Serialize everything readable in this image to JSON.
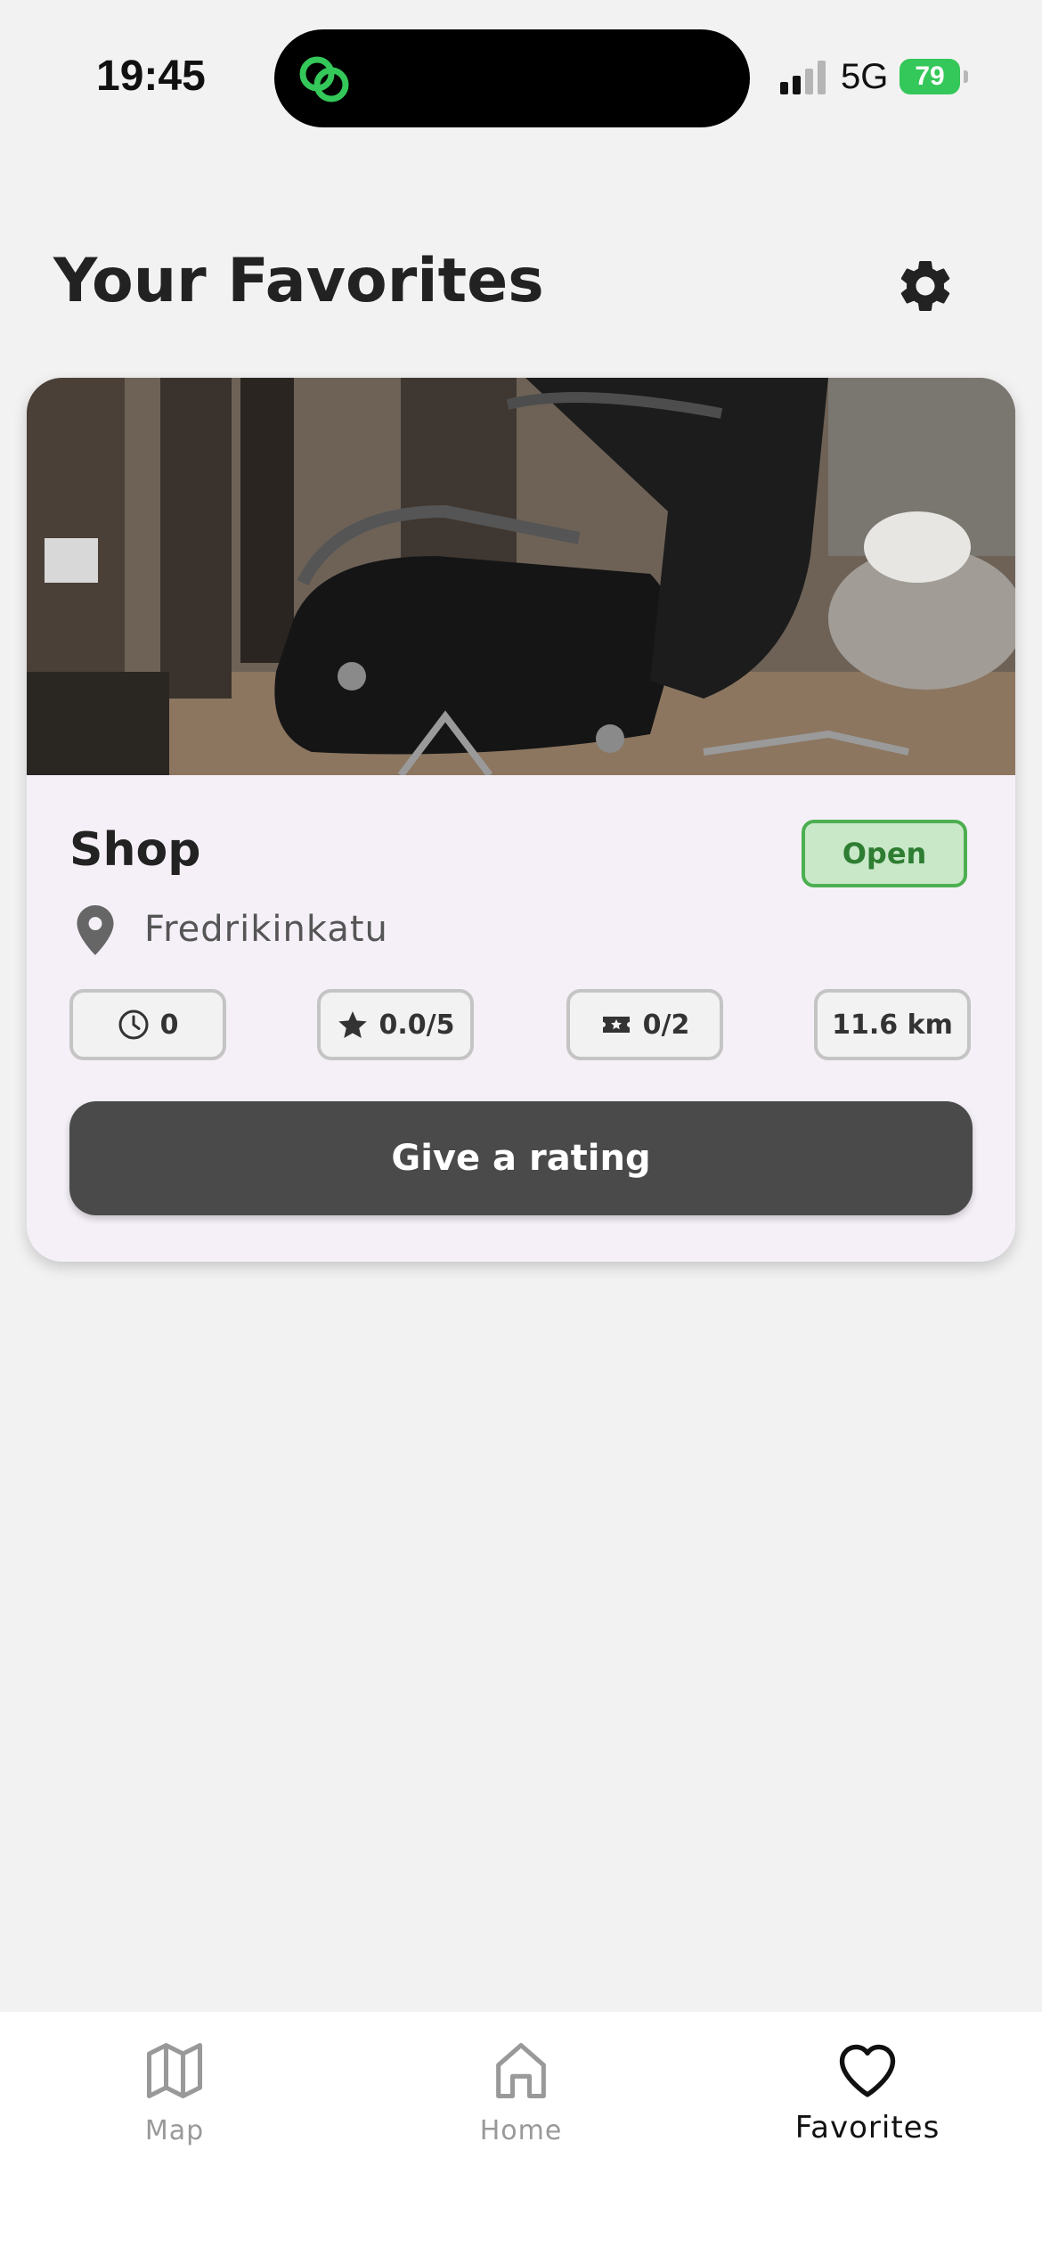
{
  "status_bar": {
    "time": "19:45",
    "network": "5G",
    "battery": "79",
    "battery_color": "#34c759",
    "island_icon": "link-rings-icon"
  },
  "header": {
    "title": "Your Favorites",
    "settings_icon": "gear-icon"
  },
  "favorites": [
    {
      "image": "barber-chair-photo",
      "name": "Shop",
      "status": "Open",
      "address": "Fredrikinkatu",
      "wait": "0",
      "rating": "0.0/5",
      "tickets": "0/2",
      "distance": "11.6 km",
      "rate_button": "Give a rating"
    }
  ],
  "bottom_nav": {
    "items": [
      {
        "label": "Map",
        "icon": "map-icon",
        "active": false
      },
      {
        "label": "Home",
        "icon": "home-icon",
        "active": false
      },
      {
        "label": "Favorites",
        "icon": "heart-icon",
        "active": true
      }
    ]
  },
  "colors": {
    "background": "#f2f2f2",
    "card": "#f5f0f8",
    "open_badge_bg": "#c8e8c8",
    "open_badge_border": "#4caf50",
    "primary_button": "#4a4a4a"
  }
}
